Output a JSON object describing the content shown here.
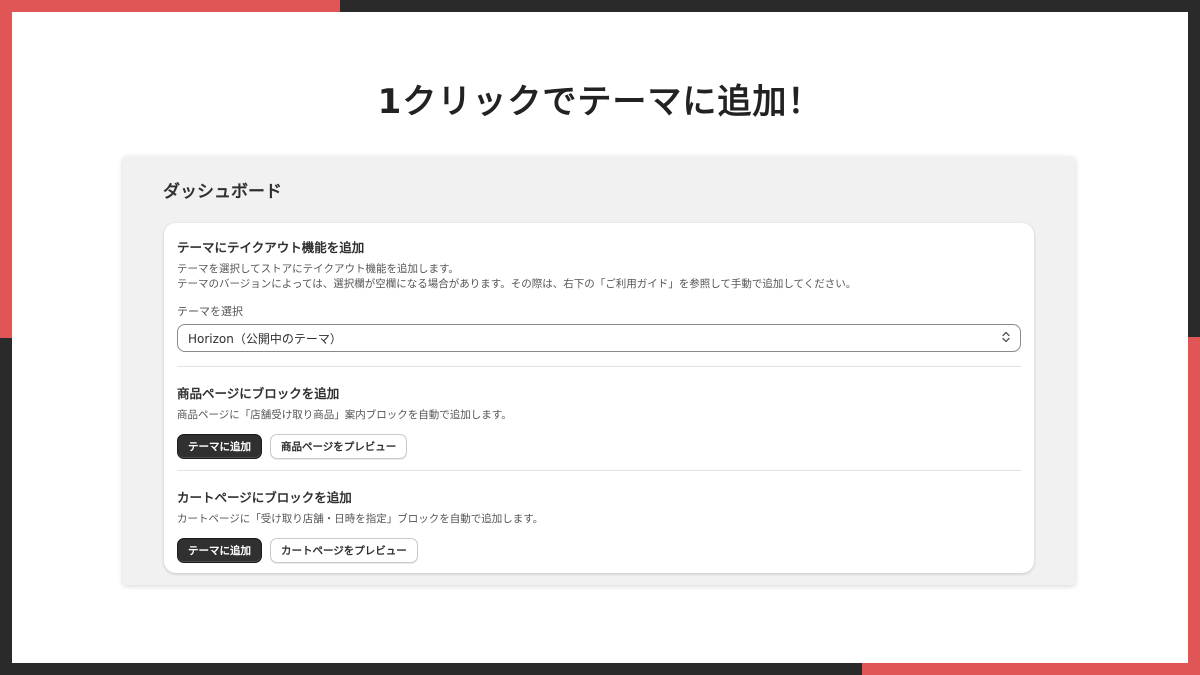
{
  "headline": "1クリックでテーマに追加！",
  "dashboard": {
    "title": "ダッシュボード",
    "theme_section": {
      "title": "テーマにテイクアウト機能を追加",
      "desc_line1": "テーマを選択してストアにテイクアウト機能を追加します。",
      "desc_line2": "テーマのバージョンによっては、選択欄が空欄になる場合があります。その際は、右下の「ご利用ガイド」を参照して手動で追加してください。",
      "select_label": "テーマを選択",
      "selected_theme": "Horizon（公開中のテーマ）"
    },
    "product_section": {
      "title": "商品ページにブロックを追加",
      "desc": "商品ページに「店舗受け取り商品」案内ブロックを自動で追加します。",
      "add_button": "テーマに追加",
      "preview_button": "商品ページをプレビュー"
    },
    "cart_section": {
      "title": "カートページにブロックを追加",
      "desc": "カートページに「受け取り店舗・日時を指定」ブロックを自動で追加します。",
      "add_button": "テーマに追加",
      "preview_button": "カートページをプレビュー"
    }
  },
  "colors": {
    "accent_red": "#e05656",
    "frame_dark": "#2a2a2a",
    "primary_button": "#303030"
  },
  "icons": {
    "select_chevron": "chevron-up-down-icon"
  }
}
